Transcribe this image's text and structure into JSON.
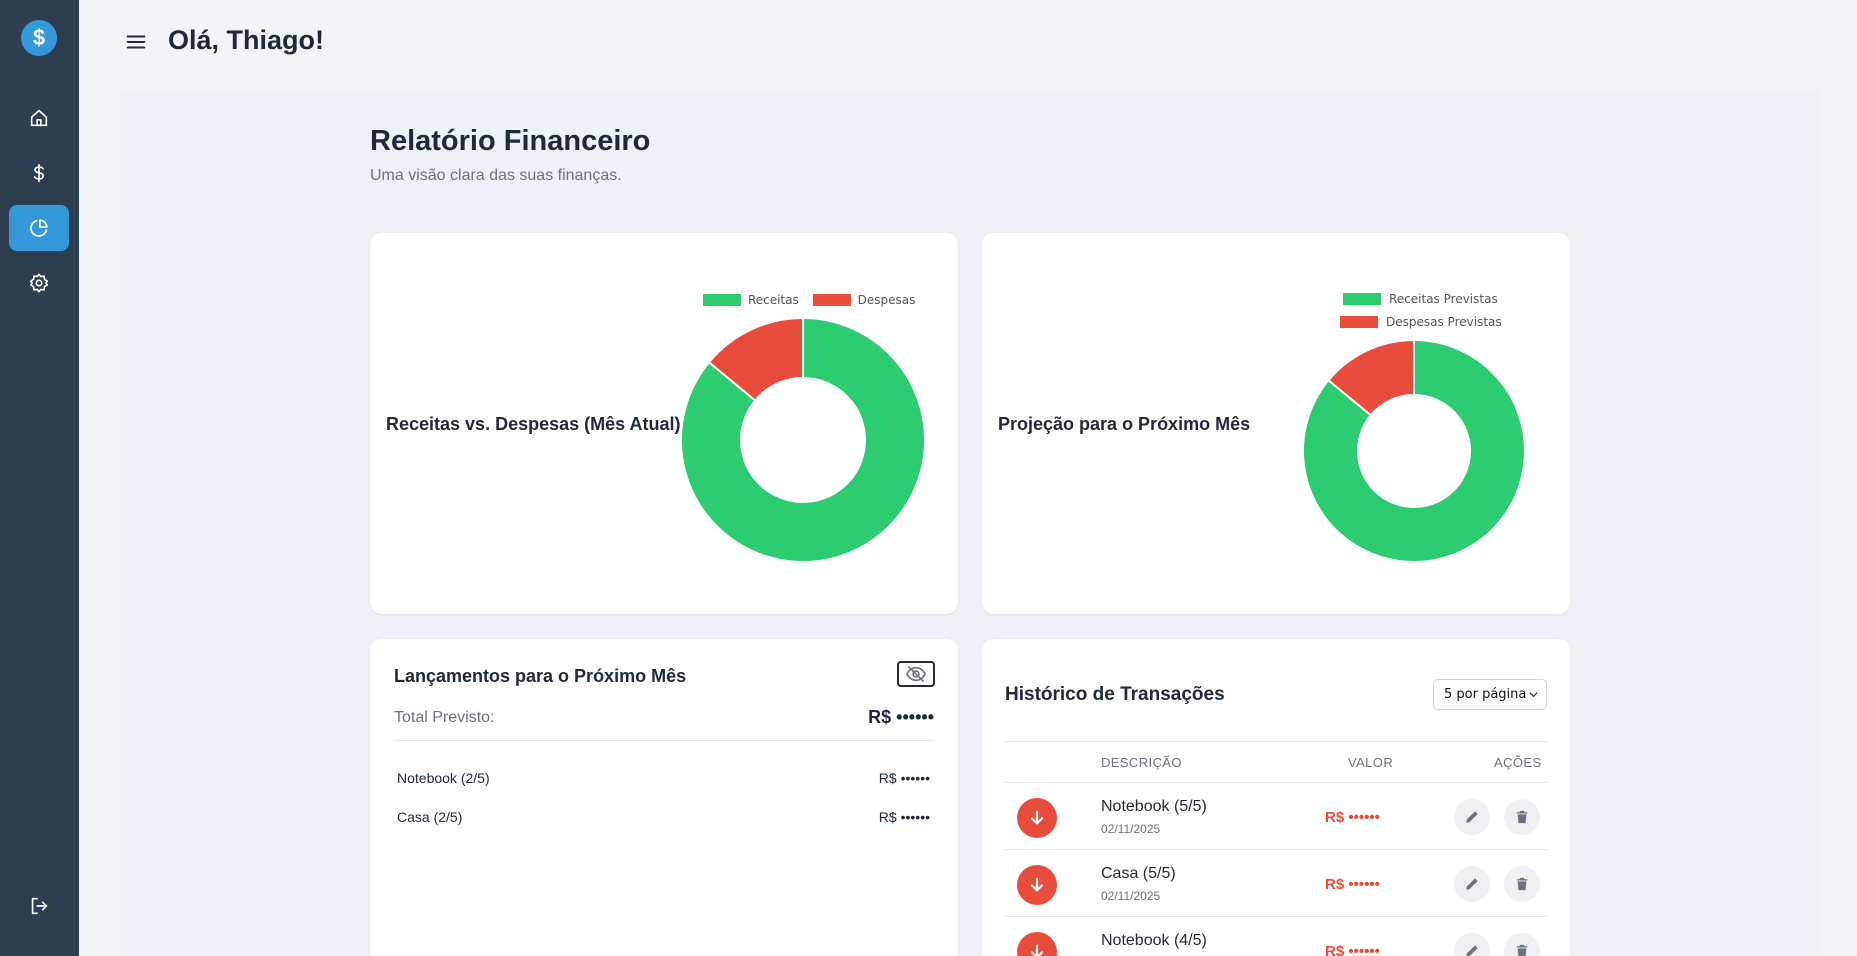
{
  "sidebar": {
    "logo": "$",
    "items": [
      {
        "name": "home",
        "icon": "home-icon"
      },
      {
        "name": "transactions",
        "icon": "dollar-icon"
      },
      {
        "name": "reports",
        "icon": "pie-chart-icon",
        "active": true
      },
      {
        "name": "settings",
        "icon": "gear-icon"
      }
    ],
    "logout_icon": "logout-icon"
  },
  "header": {
    "greeting": "Olá, Thiago!",
    "menu_icon": "hamburger-icon"
  },
  "page": {
    "title": "Relatório Financeiro",
    "subtitle": "Uma visão clara das suas finanças."
  },
  "colors": {
    "sidebar": "#2c3e50",
    "accent": "#3498db",
    "income": "#2ecc71",
    "expense": "#e74c3c"
  },
  "chart_data": [
    {
      "type": "pie",
      "title": "Receitas vs. Despesas (Mês Atual)",
      "legend": [
        "Receitas",
        "Despesas"
      ],
      "legend_position": "top",
      "values": [
        86,
        14
      ],
      "colors": [
        "#2ecc71",
        "#e74c3c"
      ],
      "donut": true
    },
    {
      "type": "pie",
      "title": "Projeção para o Próximo Mês",
      "legend": [
        "Receitas Previstas",
        "Despesas Previstas"
      ],
      "legend_position": "top",
      "values": [
        86,
        14
      ],
      "colors": [
        "#2ecc71",
        "#e74c3c"
      ],
      "donut": true
    }
  ],
  "upcoming": {
    "title": "Lançamentos para o Próximo Mês",
    "toggle_icon": "eye-off-icon",
    "total_label": "Total Previsto:",
    "total_value": "R$ ••••••",
    "items": [
      {
        "label": "Notebook (2/5)",
        "value": "R$ ••••••"
      },
      {
        "label": "Casa (2/5)",
        "value": "R$ ••••••"
      }
    ]
  },
  "history": {
    "title": "Histórico de Transações",
    "page_size": "5 por página",
    "columns": [
      "DESCRIÇÃO",
      "VALOR",
      "AÇÕES"
    ],
    "rows": [
      {
        "description": "Notebook (5/5)",
        "date": "02/11/2025",
        "value": "R$ ••••••",
        "type": "expense"
      },
      {
        "description": "Casa (5/5)",
        "date": "02/11/2025",
        "value": "R$ ••••••",
        "type": "expense"
      },
      {
        "description": "Notebook (4/5)",
        "date": "",
        "value": "R$ ••••••",
        "type": "expense"
      }
    ]
  }
}
